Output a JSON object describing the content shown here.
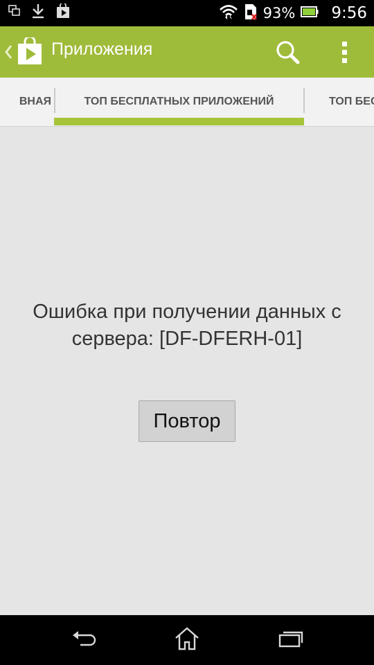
{
  "status_bar": {
    "battery_percent": "93%",
    "time": "9:56",
    "icons": [
      "screenshot-icon",
      "download-icon",
      "play-store-notification-icon",
      "wifi-icon",
      "sim-icon",
      "battery-icon"
    ]
  },
  "action_bar": {
    "title": "Приложения",
    "color": "#9fbb3a"
  },
  "tabs": [
    {
      "label": "ВНАЯ"
    },
    {
      "label": "ТОП БЕСПЛАТНЫХ ПРИЛОЖЕНИЙ",
      "selected": true
    },
    {
      "label": "ТОП БЕСП"
    }
  ],
  "content": {
    "error_message": "Ошибка при получении данных с сервера: [DF-DFERH-01]",
    "retry_label": "Повтор"
  },
  "nav_bar": {
    "icons": [
      "back-icon",
      "home-icon",
      "recent-apps-icon"
    ]
  }
}
